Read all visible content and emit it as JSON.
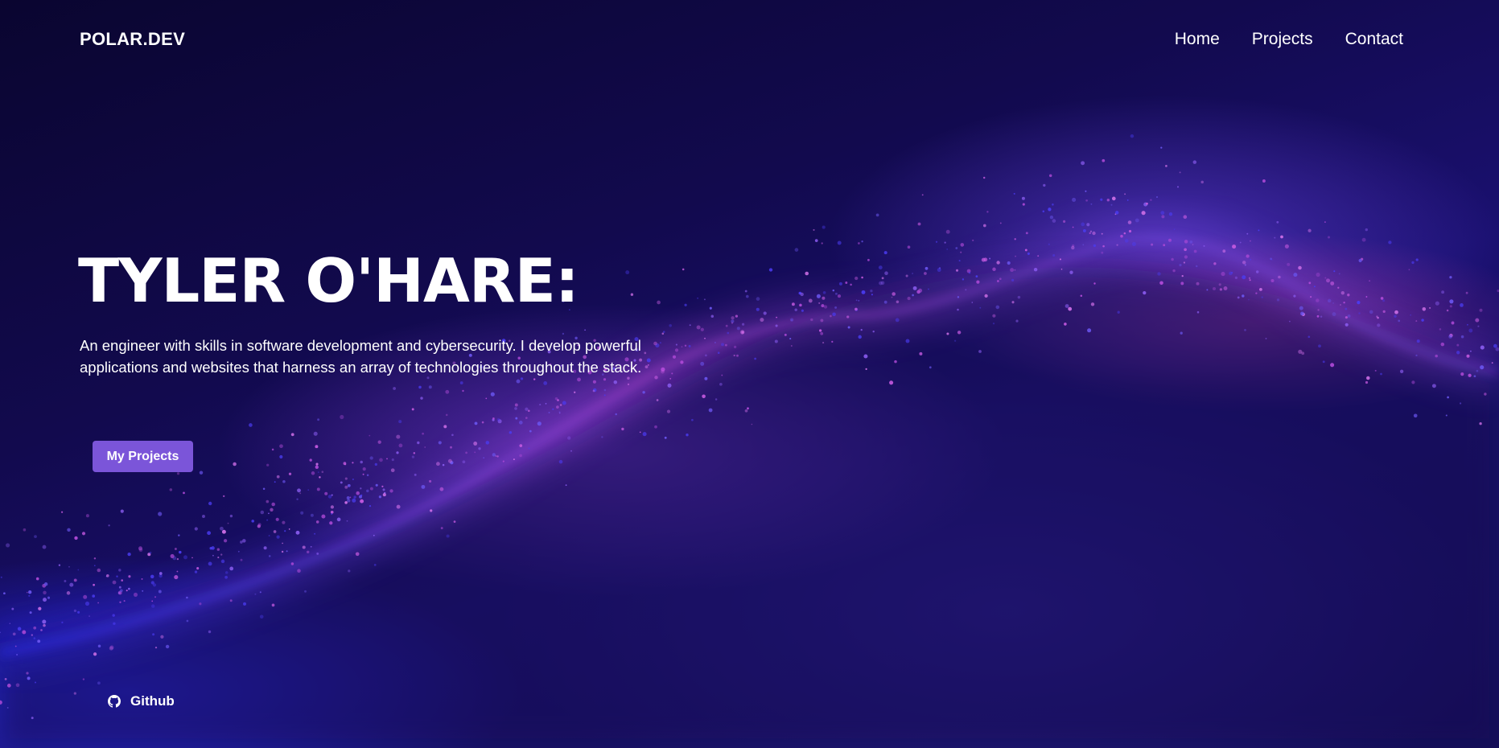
{
  "nav": {
    "brand": "POLAR.DEV",
    "links": [
      "Home",
      "Projects",
      "Contact"
    ]
  },
  "hero": {
    "title": "TYLER O'HARE:",
    "description": "An engineer with skills in software development and cybersecurity. I develop powerful applications and websites that harness an array of technologies throughout the stack.",
    "cta_label": "My Projects"
  },
  "footer": {
    "github_label": "Github",
    "github_icon": "github-icon"
  },
  "colors": {
    "background": "#0b0633",
    "accent": "#7b55d9",
    "particle_pink": "#c04ad8",
    "particle_blue": "#3a2ff0",
    "text": "#ffffff"
  }
}
